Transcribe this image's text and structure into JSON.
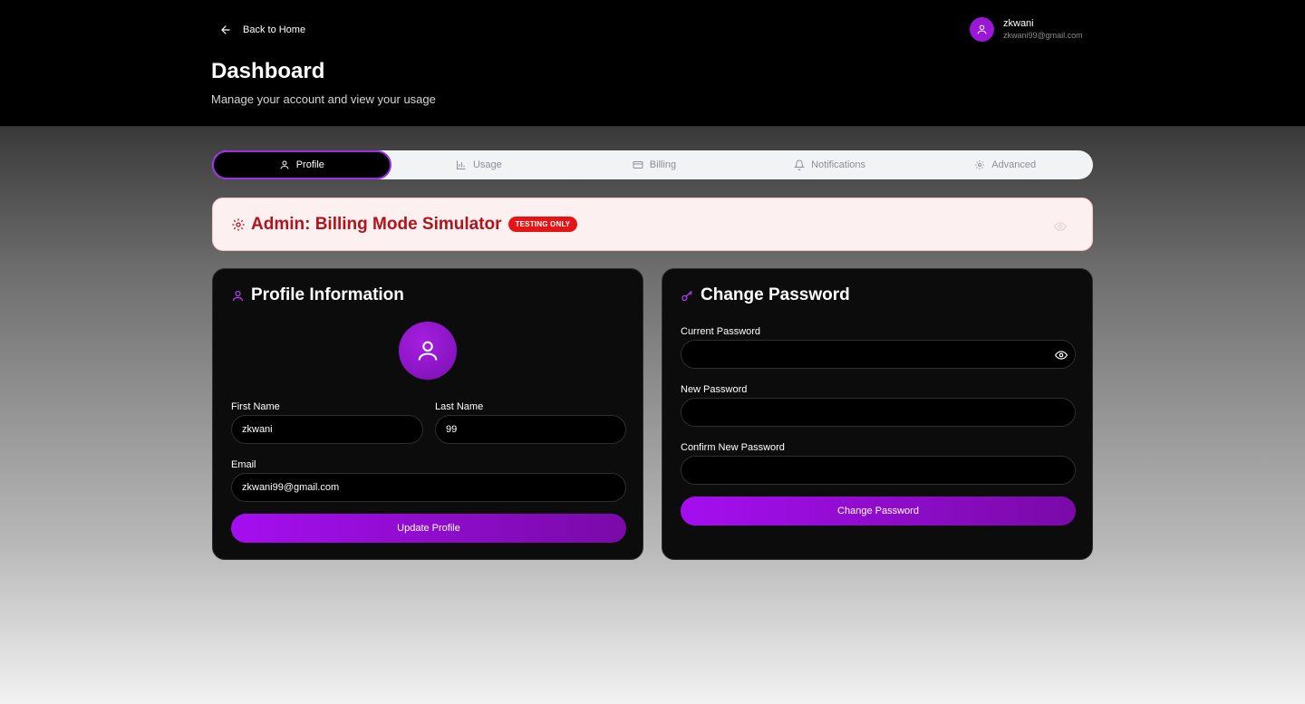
{
  "header": {
    "back_label": "Back to Home",
    "title": "Dashboard",
    "subtitle": "Manage your account and view your usage",
    "user": {
      "name": "zkwani",
      "email": "zkwani99@gmail.com"
    }
  },
  "tabs": [
    {
      "label": "Profile",
      "icon": "user-icon",
      "active": true
    },
    {
      "label": "Usage",
      "icon": "bar-chart-icon",
      "active": false
    },
    {
      "label": "Billing",
      "icon": "credit-card-icon",
      "active": false
    },
    {
      "label": "Notifications",
      "icon": "bell-icon",
      "active": false
    },
    {
      "label": "Advanced",
      "icon": "gear-icon",
      "active": false
    }
  ],
  "admin_banner": {
    "title": "Admin: Billing Mode Simulator",
    "badge": "TESTING ONLY"
  },
  "profile": {
    "title": "Profile Information",
    "first_name_label": "First Name",
    "first_name": "zkwani",
    "last_name_label": "Last Name",
    "last_name": "99",
    "email_label": "Email",
    "email": "zkwani99@gmail.com",
    "submit_label": "Update Profile"
  },
  "password": {
    "title": "Change Password",
    "current_label": "Current Password",
    "new_label": "New Password",
    "confirm_label": "Confirm New Password",
    "submit_label": "Change Password"
  },
  "colors": {
    "accent": "#a40ef0",
    "banner_text": "#b1131b",
    "badge": "#e61515"
  }
}
